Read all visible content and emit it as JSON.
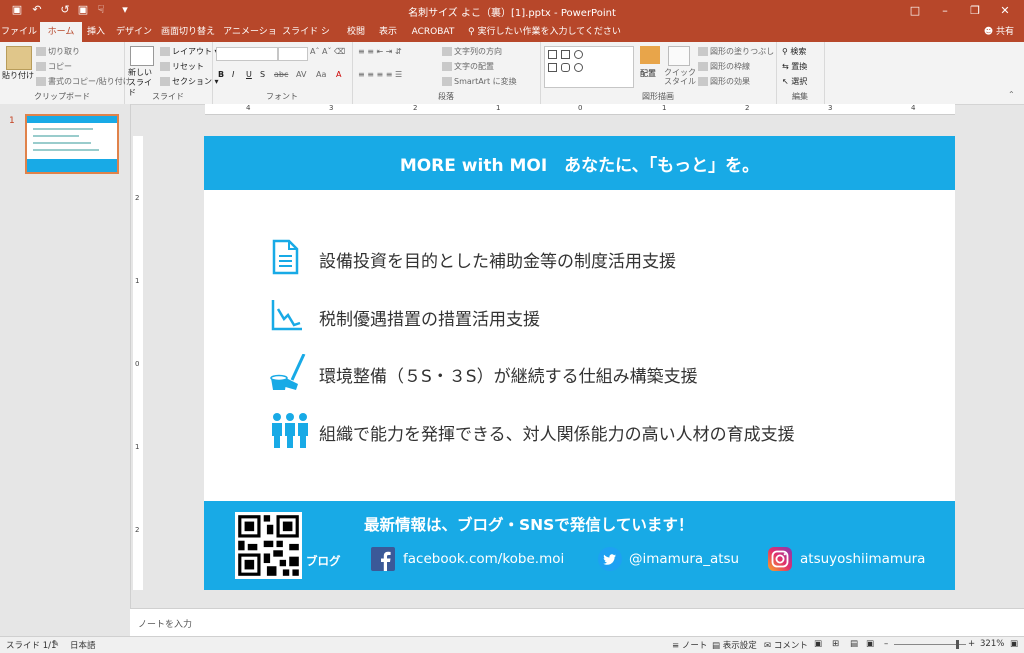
{
  "window": {
    "title": "名刺サイズ よこ（裏）[1].pptx  -  PowerPoint",
    "qat": [
      "save-icon",
      "undo-icon",
      "redo-icon",
      "present-icon",
      "touch-icon",
      "customize-icon"
    ]
  },
  "tabs": [
    "ファイル",
    "ホーム",
    "挿入",
    "デザイン",
    "画面切り替え",
    "アニメーション",
    "スライド ショー",
    "校閲",
    "表示",
    "ACROBAT"
  ],
  "active_tab": "ホーム",
  "tellme": "実行したい作業を入力してください",
  "share": "共有",
  "ribbon": {
    "clipboard": {
      "label": "クリップボード",
      "paste": "貼り付け",
      "cut": "切り取り",
      "copy": "コピー",
      "format_painter": "書式のコピー/貼り付け"
    },
    "slides": {
      "label": "スライド",
      "new_slide": "新しい スライド",
      "layout": "レイアウト",
      "reset": "リセット",
      "section": "セクション"
    },
    "font": {
      "label": "フォント",
      "buttons": [
        "B",
        "I",
        "U",
        "S",
        "abc",
        "AV",
        "Aa",
        "A"
      ]
    },
    "paragraph": {
      "label": "段落",
      "text_direction": "文字列の方向",
      "align_text": "文字の配置",
      "smartart": "SmartArt に変換"
    },
    "drawing": {
      "label": "図形描画",
      "arrange": "配置",
      "quick_styles": "クイック スタイル",
      "shape_fill": "図形の塗りつぶし",
      "shape_outline": "図形の枠線",
      "shape_effects": "図形の効果"
    },
    "editing": {
      "label": "編集",
      "find": "検索",
      "replace": "置換",
      "select": "選択"
    }
  },
  "ruler": {
    "labels": [
      "4",
      "3",
      "2",
      "1",
      "0",
      "1",
      "2",
      "3",
      "4"
    ]
  },
  "vruler": {
    "labels": [
      "2",
      "1",
      "0",
      "1",
      "2"
    ]
  },
  "thumbnail": {
    "number": "1"
  },
  "slide": {
    "header": "MORE with MOI　あなたに、「もっと」を。",
    "bullets": [
      {
        "icon": "document-icon",
        "text": "設備投資を目的とした補助金等の制度活用支援"
      },
      {
        "icon": "chart-down-icon",
        "text": "税制優遇措置の措置活用支援"
      },
      {
        "icon": "broom-bucket-icon",
        "text": "環境整備（５S・３S）が継続する仕組み構築支援"
      },
      {
        "icon": "people-icon",
        "text": "組織で能力を発揮できる、対人関係能力の高い人材の育成支援"
      }
    ],
    "footer_title": "最新情報は、ブログ・SNSで発信しています！",
    "blog_label": "ブログ",
    "facebook": "facebook.com/kobe.moi",
    "twitter": "@imamura_atsu",
    "instagram": "atsuyoshiimamura",
    "accent": "#18aae6"
  },
  "notes_placeholder": "ノートを入力",
  "status": {
    "slide": "スライド 1/1",
    "language": "日本語",
    "notes": "ノート",
    "display": "表示設定",
    "comments": "コメント",
    "zoom": "321%"
  }
}
